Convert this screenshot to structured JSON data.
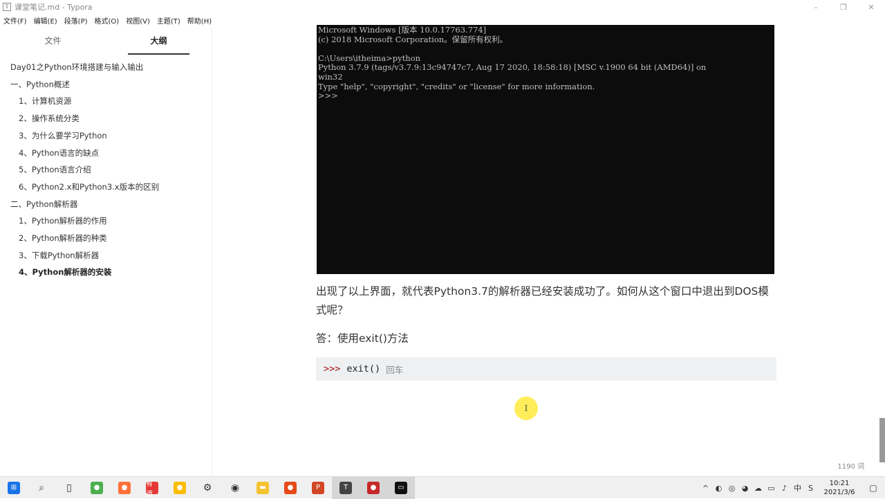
{
  "window": {
    "title": "课堂笔记.md - Typora",
    "icon_letter": "T"
  },
  "menu": [
    "文件(F)",
    "编辑(E)",
    "段落(P)",
    "格式(O)",
    "视图(V)",
    "主题(T)",
    "帮助(H)"
  ],
  "sidebar": {
    "tabs": [
      {
        "label": "文件"
      },
      {
        "label": "大纲"
      }
    ],
    "outline": [
      {
        "text": "Day01之Python环境搭建与输入输出",
        "level": 1
      },
      {
        "text": "一、Python概述",
        "level": 2
      },
      {
        "text": "1、计算机资源",
        "level": 3
      },
      {
        "text": "2、操作系统分类",
        "level": 3
      },
      {
        "text": "3、为什么要学习Python",
        "level": 3
      },
      {
        "text": "4、Python语言的缺点",
        "level": 3
      },
      {
        "text": "5、Python语言介绍",
        "level": 3
      },
      {
        "text": "6、Python2.x和Python3.x版本的区别",
        "level": 3
      },
      {
        "text": "二、Python解析器",
        "level": 2
      },
      {
        "text": "1、Python解析器的作用",
        "level": 3
      },
      {
        "text": "2、Python解析器的种类",
        "level": 3
      },
      {
        "text": "3、下载Python解析器",
        "level": 3
      },
      {
        "text": "4、Python解析器的安装",
        "level": 3,
        "active": true
      }
    ],
    "footer": {
      "back": "<",
      "source": "</>"
    }
  },
  "editor": {
    "terminal_lines": [
      "Microsoft Windows [版本 10.0.17763.774]",
      "(c) 2018 Microsoft Corporation。保留所有权利。",
      "",
      "C:\\Users\\itheima>python",
      "Python 3.7.9 (tags/v3.7.9:13c94747c7, Aug 17 2020, 18:58:18) [MSC v.1900 64 bit (AMD64)] on",
      "win32",
      "Type \"help\", \"copyright\", \"credits\" or \"license\" for more information.",
      ">>>"
    ],
    "paragraph": "出现了以上界面，就代表Python3.7的解析器已经安装成功了。如何从这个窗口中退出到DOS模式呢？",
    "answer": "答：使用exit()方法",
    "code": {
      "prompt": ">>>",
      "command": "exit()",
      "comment": "回车"
    },
    "cursor_glyph": "I",
    "word_count": "1190 词"
  },
  "taskbar": {
    "apps": [
      {
        "name": "start",
        "glyph": "⊞",
        "color": "#1a73e8"
      },
      {
        "name": "search",
        "glyph": "⌕",
        "color": "#333"
      },
      {
        "name": "task-view",
        "glyph": "▯",
        "color": "#333"
      },
      {
        "name": "chrome",
        "glyph": "●",
        "color": "#4caf50"
      },
      {
        "name": "firefox",
        "glyph": "●",
        "color": "#ff7139"
      },
      {
        "name": "youdao",
        "glyph": "有道",
        "color": "#e53935"
      },
      {
        "name": "chrome-2",
        "glyph": "●",
        "color": "#fbbc05"
      },
      {
        "name": "settings",
        "glyph": "⚙",
        "color": "#333"
      },
      {
        "name": "app-circle",
        "glyph": "◉",
        "color": "#333"
      },
      {
        "name": "explorer",
        "glyph": "▬",
        "color": "#f4c430"
      },
      {
        "name": "recorder",
        "glyph": "●",
        "color": "#e64a19"
      },
      {
        "name": "powerpoint",
        "glyph": "P",
        "color": "#d24726"
      },
      {
        "name": "typora",
        "glyph": "T",
        "color": "#444"
      },
      {
        "name": "screen-record",
        "glyph": "●",
        "color": "#c62828"
      },
      {
        "name": "cmd",
        "glyph": "▭",
        "color": "#111"
      }
    ],
    "active_indexes": [
      12,
      13,
      14
    ],
    "tray": [
      "^",
      "◐",
      "◎",
      "◕",
      "☁",
      "▭",
      "♪",
      "中",
      "S"
    ],
    "time": "10:21",
    "date": "2021/3/6",
    "notify_glyph": "▢"
  }
}
